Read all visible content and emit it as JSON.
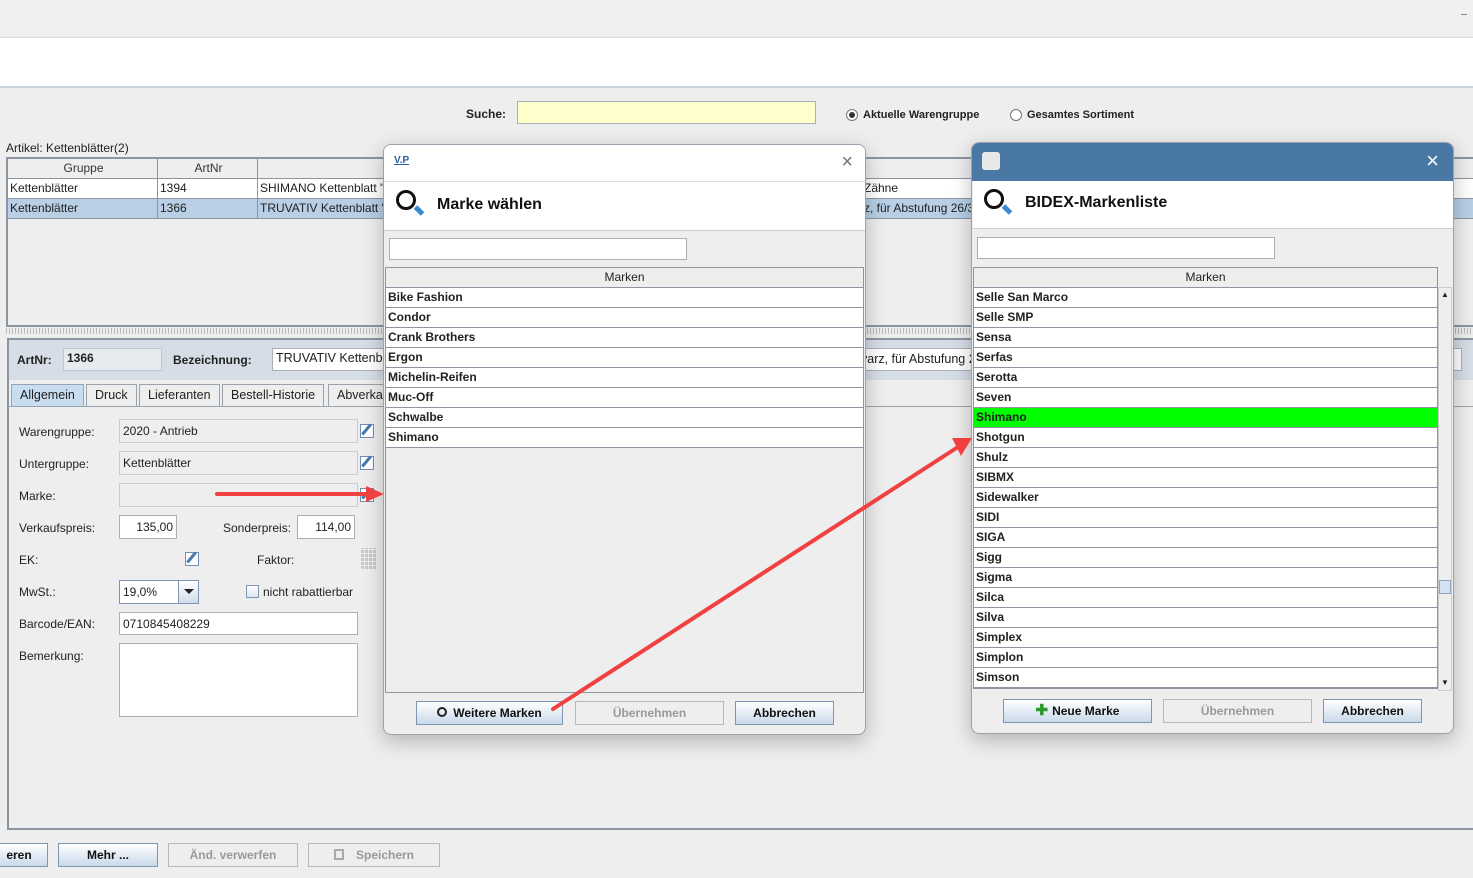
{
  "search": {
    "label": "Suche:",
    "value": "",
    "radio_current": "Aktuelle Warengruppe",
    "radio_all": "Gesamtes Sortiment",
    "selected": "Aktuelle Warengruppe"
  },
  "articles": {
    "title": "Artikel: Kettenblätter(2)",
    "headers": [
      "Gruppe",
      "ArtNr",
      ""
    ],
    "rows": [
      {
        "gruppe": "Kettenblätter",
        "artnr": "1394",
        "bez": "SHIMANO Kettenblatt \"I",
        "tail": "Zähne"
      },
      {
        "gruppe": "Kettenblätter",
        "artnr": "1366",
        "bez": "TRUVATIV Kettenblatt \"",
        "tail": "z, für Abstufung 26/3"
      }
    ]
  },
  "detail": {
    "artnr_label": "ArtNr:",
    "artnr": "1366",
    "bez_label": "Bezeichnung:",
    "bez": "TRUVATIV Kettenbla",
    "bez_tail": "varz, für Abstufung 2",
    "tabs": [
      "Allgemein",
      "Druck",
      "Lieferanten",
      "Bestell-Historie",
      "Abverkau"
    ],
    "warengruppe_label": "Warengruppe:",
    "warengruppe": "2020 - Antrieb",
    "untergruppe_label": "Untergruppe:",
    "untergruppe": "Kettenblätter",
    "marke_label": "Marke:",
    "marke": "",
    "vk_label": "Verkaufspreis:",
    "vk": "135,00",
    "sonder_label": "Sonderpreis:",
    "sonder": "114,00",
    "ek_label": "EK:",
    "faktor_label": "Faktor:",
    "mwst_label": "MwSt.:",
    "mwst": "19,0%",
    "rabatt_label": "nicht rabattierbar",
    "barcode_label": "Barcode/EAN:",
    "barcode": "0710845408229",
    "bemerkung_label": "Bemerkung:"
  },
  "bottom": {
    "b0": "eren",
    "b1": "Mehr ...",
    "b2": "Änd. verwerfen",
    "b3": "Speichern"
  },
  "dialog1": {
    "icon_text": "V.P",
    "title": "Marke wählen",
    "header": "Marken",
    "items": [
      "Bike Fashion",
      "Condor",
      "Crank Brothers",
      "Ergon",
      "Michelin-Reifen",
      "Muc-Off",
      "Schwalbe",
      "Shimano"
    ],
    "more": "Weitere Marken",
    "apply": "Übernehmen",
    "cancel": "Abbrechen"
  },
  "dialog2": {
    "title": "BIDEX-Markenliste",
    "header": "Marken",
    "titlebar_color": "#4a78a4",
    "highlight_color": "#00ff00",
    "selected": "Shimano",
    "items": [
      "Selle San Marco",
      "Selle SMP",
      "Sensa",
      "Serfas",
      "Serotta",
      "Seven",
      "Shimano",
      "Shotgun",
      "Shulz",
      "SIBMX",
      "Sidewalker",
      "SIDI",
      "SIGA",
      "Sigg",
      "Sigma",
      "Silca",
      "Silva",
      "Simplex",
      "Simplon",
      "Simson"
    ],
    "new": "Neue Marke",
    "apply": "Übernehmen",
    "cancel": "Abbrechen"
  },
  "annotation_color": "#f04040"
}
